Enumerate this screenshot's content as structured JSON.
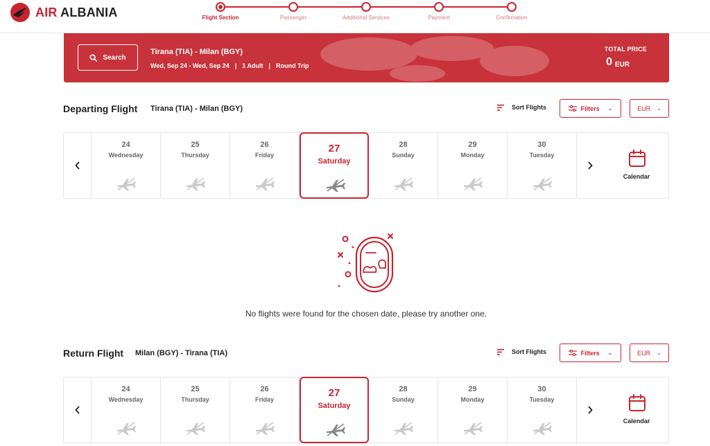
{
  "brand": {
    "name": "AIR ALBANIA",
    "name_part1": "AIR",
    "name_part2": " ALBANIA",
    "color": "#c8242f"
  },
  "steps": [
    {
      "label": "Flight Section",
      "active": true
    },
    {
      "label": "Passenger",
      "active": false
    },
    {
      "label": "Additional Services",
      "active": false
    },
    {
      "label": "Payment",
      "active": false
    },
    {
      "label": "Confirmation",
      "active": false
    }
  ],
  "search_summary": {
    "search_label": "Search",
    "route": "Tirana (TIA) - Milan (BGY)",
    "dates": "Wed, Sep 24 - Wed, Sep 24",
    "passengers": "1 Adult",
    "trip_type": "Round Trip",
    "separator": "|",
    "total_price_label": "TOTAL PRICE",
    "total_price_value": "0",
    "total_price_currency": "EUR"
  },
  "departing": {
    "title": "Departing Flight",
    "route": "Tirana (TIA) - Milan (BGY)",
    "sort_label": "Sort Flights",
    "filters_label": "Filters",
    "currency": "EUR",
    "calendar_label": "Calendar",
    "days": [
      {
        "num": "24",
        "name": "Wednesday"
      },
      {
        "num": "25",
        "name": "Thursday"
      },
      {
        "num": "26",
        "name": "Friday"
      },
      {
        "num": "27",
        "name": "Saturday",
        "selected": true
      },
      {
        "num": "28",
        "name": "Sunday"
      },
      {
        "num": "29",
        "name": "Monday"
      },
      {
        "num": "30",
        "name": "Tuesday"
      }
    ]
  },
  "empty_state": {
    "message": "No flights were found for the chosen date, please try another one."
  },
  "return": {
    "title": "Return Flight",
    "route": "Milan (BGY) - Tirana (TIA)",
    "sort_label": "Sort Flights",
    "filters_label": "Filters",
    "currency": "EUR",
    "calendar_label": "Calendar",
    "days": [
      {
        "num": "24",
        "name": "Wednesday"
      },
      {
        "num": "25",
        "name": "Thursday"
      },
      {
        "num": "26",
        "name": "Friday"
      },
      {
        "num": "27",
        "name": "Saturday",
        "selected": true
      },
      {
        "num": "28",
        "name": "Sunday"
      },
      {
        "num": "29",
        "name": "Monday"
      },
      {
        "num": "30",
        "name": "Tuesday"
      }
    ]
  },
  "icons": {
    "logo": "eagle-logo-icon",
    "search": "search-icon",
    "sort": "sort-icon",
    "filters": "sliders-icon",
    "dropdown": "chevron-down-icon",
    "prev": "chevron-left-icon",
    "next": "chevron-right-icon",
    "day": "no-flight-plane-icon",
    "calendar": "calendar-icon",
    "empty": "airplane-window-icon"
  }
}
